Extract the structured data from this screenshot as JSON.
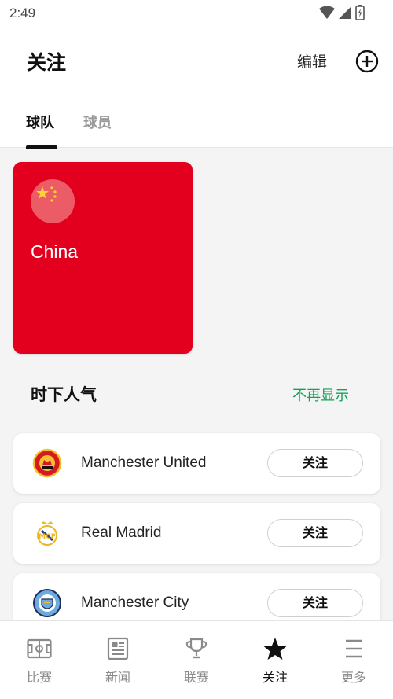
{
  "status_bar": {
    "time": "2:49"
  },
  "header": {
    "title": "关注",
    "edit_label": "编辑"
  },
  "tabs": [
    {
      "label": "球队",
      "active": true
    },
    {
      "label": "球员",
      "active": false
    }
  ],
  "followed_team": {
    "name": "China",
    "card_color": "#e2001e",
    "flag": "china-flag-icon"
  },
  "popular": {
    "title": "时下人气",
    "dismiss_label": "不再显示",
    "dismiss_color": "#14a05a",
    "clubs": [
      {
        "name": "Manchester United",
        "follow_label": "关注",
        "logo": "manchester-united-crest-icon"
      },
      {
        "name": "Real Madrid",
        "follow_label": "关注",
        "logo": "real-madrid-crest-icon"
      },
      {
        "name": "Manchester City",
        "follow_label": "关注",
        "logo": "manchester-city-crest-icon"
      }
    ]
  },
  "bottom_nav": [
    {
      "label": "比赛",
      "icon": "pitch-icon",
      "active": false
    },
    {
      "label": "新闻",
      "icon": "newspaper-icon",
      "active": false
    },
    {
      "label": "联赛",
      "icon": "trophy-icon",
      "active": false
    },
    {
      "label": "关注",
      "icon": "star-icon",
      "active": true
    },
    {
      "label": "更多",
      "icon": "menu-icon",
      "active": false
    }
  ]
}
